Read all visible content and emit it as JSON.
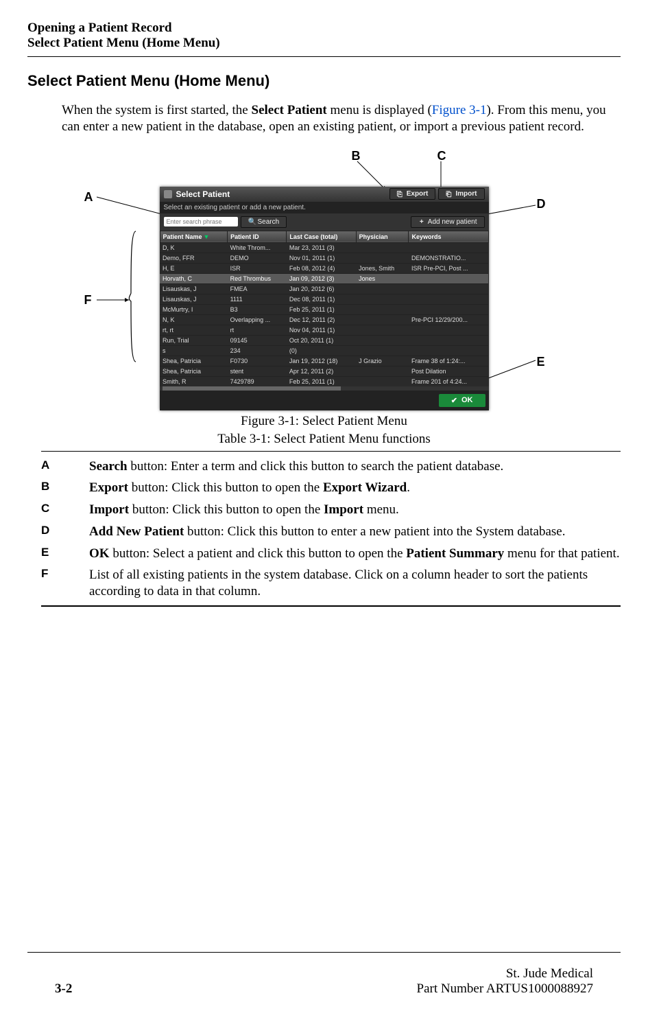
{
  "header": {
    "line1": "Opening a Patient Record",
    "line2": "Select Patient Menu (Home Menu)"
  },
  "section_title": "Select Patient Menu (Home Menu)",
  "body_para_pre": "When the system is first started, the ",
  "body_para_bold1": "Select Patient",
  "body_para_mid": " menu is displayed (",
  "body_para_figref": "Figure 3-1",
  "body_para_post": "). From this menu, you can enter a new patient in the database,  open an existing patient, or import a previous patient record.",
  "callouts": {
    "A": "A",
    "B": "B",
    "C": "C",
    "D": "D",
    "E": "E",
    "F": "F"
  },
  "app": {
    "title": "Select Patient",
    "export_label": "Export",
    "import_label": "Import",
    "subtitle": "Select an existing patient or add a new patient.",
    "search_placeholder": "Enter search phrase",
    "search_btn": "Search",
    "addnew_btn": "Add new patient",
    "ok_btn": "OK",
    "columns": [
      "Patient Name",
      "Patient ID",
      "Last Case (total)",
      "Physician",
      "Keywords"
    ],
    "rows": [
      {
        "name": "D, K",
        "id": "White Throm...",
        "date": "Mar 23, 2011  (3)",
        "phys": "",
        "kw": ""
      },
      {
        "name": "Demo, FFR",
        "id": "DEMO",
        "date": "Nov 01, 2011  (1)",
        "phys": "",
        "kw": "DEMONSTRATIO..."
      },
      {
        "name": "H, E",
        "id": "ISR",
        "date": "Feb 08, 2012  (4)",
        "phys": "Jones, Smith",
        "kw": "ISR Pre-PCI, Post ..."
      },
      {
        "name": "Horvath, C",
        "id": "Red Thrombus",
        "date": "Jan 09, 2012  (3)",
        "phys": "Jones",
        "kw": "",
        "selected": true
      },
      {
        "name": "Lisauskas, J",
        "id": "FMEA",
        "date": "Jan 20, 2012  (6)",
        "phys": "",
        "kw": ""
      },
      {
        "name": "Lisauskas, J",
        "id": "1111",
        "date": "Dec 08, 2011  (1)",
        "phys": "",
        "kw": ""
      },
      {
        "name": "McMurtry, I",
        "id": "B3",
        "date": "Feb 25, 2011  (1)",
        "phys": "",
        "kw": ""
      },
      {
        "name": "N, K",
        "id": "Overlapping ...",
        "date": "Dec 12, 2011  (2)",
        "phys": "",
        "kw": "Pre-PCI 12/29/200..."
      },
      {
        "name": "rt, rt",
        "id": "rt",
        "date": "Nov 04, 2011  (1)",
        "phys": "",
        "kw": ""
      },
      {
        "name": "Run, Trial",
        "id": "09145",
        "date": "Oct 20, 2011  (1)",
        "phys": "",
        "kw": ""
      },
      {
        "name": "s",
        "id": "234",
        "date": "                (0)",
        "phys": "",
        "kw": ""
      },
      {
        "name": "Shea, Patricia",
        "id": "F0730",
        "date": "Jan 19, 2012  (18)",
        "phys": "J Grazio",
        "kw": "Frame 38 of 1:24:..."
      },
      {
        "name": "Shea, Patricia",
        "id": "stent",
        "date": "Apr 12, 2011  (2)",
        "phys": "",
        "kw": "Post Dilation"
      },
      {
        "name": "Smith, R",
        "id": "7429789",
        "date": "Feb 25, 2011  (1)",
        "phys": "",
        "kw": "Frame 201 of 4:24..."
      }
    ]
  },
  "figure_caption": "Figure 3-1:  Select Patient Menu",
  "table_caption": "Table 3-1:  Select Patient Menu functions",
  "desc": {
    "A": {
      "pre": "",
      "b1": "Search",
      "post": " button: Enter a term and click this button to search the patient database."
    },
    "B": {
      "b1": "Export",
      "mid": " button: Click this button to open the ",
      "b2": "Export Wizard",
      "post": "."
    },
    "C": {
      "b1": "Import",
      "mid": " button: Click this button to open the ",
      "b2": "Import",
      "post": " menu."
    },
    "D": {
      "b1": "Add New Patient",
      "post": " button: Click this button to enter a new patient into the System database."
    },
    "E": {
      "b1": "OK",
      "mid": " button: Select a patient and click this button to open the ",
      "b2": "Patient Summary",
      "post": " menu for that patient."
    },
    "F": {
      "pre": "List of ",
      "post": "all existing patients in the system database. Click on a column header to sort the patients according to data in that column."
    }
  },
  "footer": {
    "page": "3-2",
    "company": "St. Jude Medical",
    "partnum": "Part Number ARTUS1000088927"
  }
}
